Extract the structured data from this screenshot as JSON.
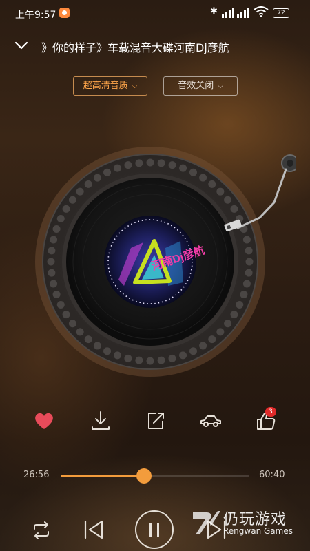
{
  "status": {
    "time": "上午9:57",
    "battery": "72"
  },
  "header": {
    "title": "》你的样子》车载混音大碟河南Dj彦航"
  },
  "options": {
    "quality_label": "超高清音质",
    "effect_label": "音效关闭"
  },
  "album_art": {
    "logo_text": "河南Dj彦航"
  },
  "actions": {
    "comment_count": "3"
  },
  "progress": {
    "current_time": "26:56",
    "total_time": "60:40",
    "fraction": 0.44
  },
  "watermark": {
    "name": "仍玩游戏",
    "sub": "Rengwan Games"
  },
  "colors": {
    "accent": "#f39c3c",
    "like": "#e84b5a",
    "badge": "#e02a2a"
  }
}
